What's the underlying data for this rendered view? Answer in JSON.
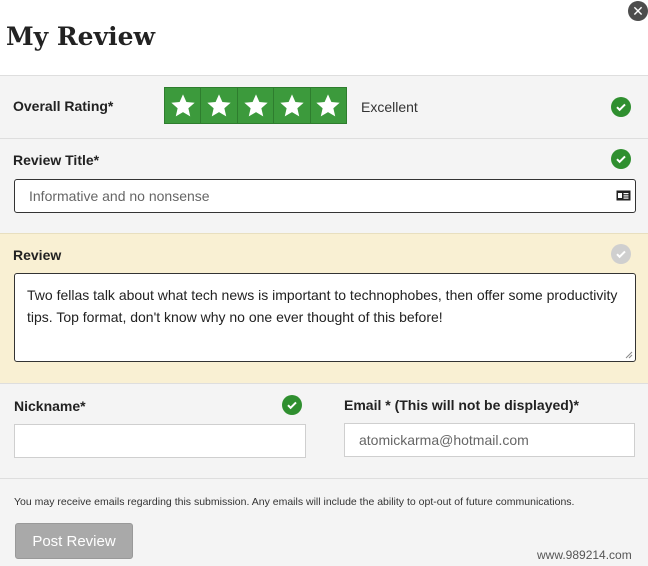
{
  "page": {
    "title": "My Review",
    "close_icon": "close-icon",
    "watermark": "www.989214.com"
  },
  "rating": {
    "label": "Overall Rating*",
    "value": 5,
    "max": 5,
    "text": "Excellent",
    "star_color": "#3c9a3c",
    "status": "valid"
  },
  "review_title": {
    "label": "Review Title*",
    "value": "Informative and no nonsense",
    "status": "valid",
    "field_icon": "contact-card-icon"
  },
  "review": {
    "label": "Review",
    "value": "Two fellas talk about what tech news is important to technophobes, then offer some productivity tips. Top format, don't know why no one ever thought of this before!",
    "status": "pending",
    "highlight_color": "#f9f0d3"
  },
  "nickname": {
    "label": "Nickname*",
    "value": "",
    "status": "valid"
  },
  "email": {
    "label": "Email * (This will not be displayed)*",
    "placeholder": "atomickarma@hotmail.com"
  },
  "footer": {
    "notice": "You may receive emails regarding this submission. Any emails will include the ability to opt-out of future communications.",
    "post_label": "Post Review"
  },
  "colors": {
    "valid": "#2f8f2f",
    "pending": "#cfcfcf",
    "button_disabled": "#a9a9a9"
  }
}
